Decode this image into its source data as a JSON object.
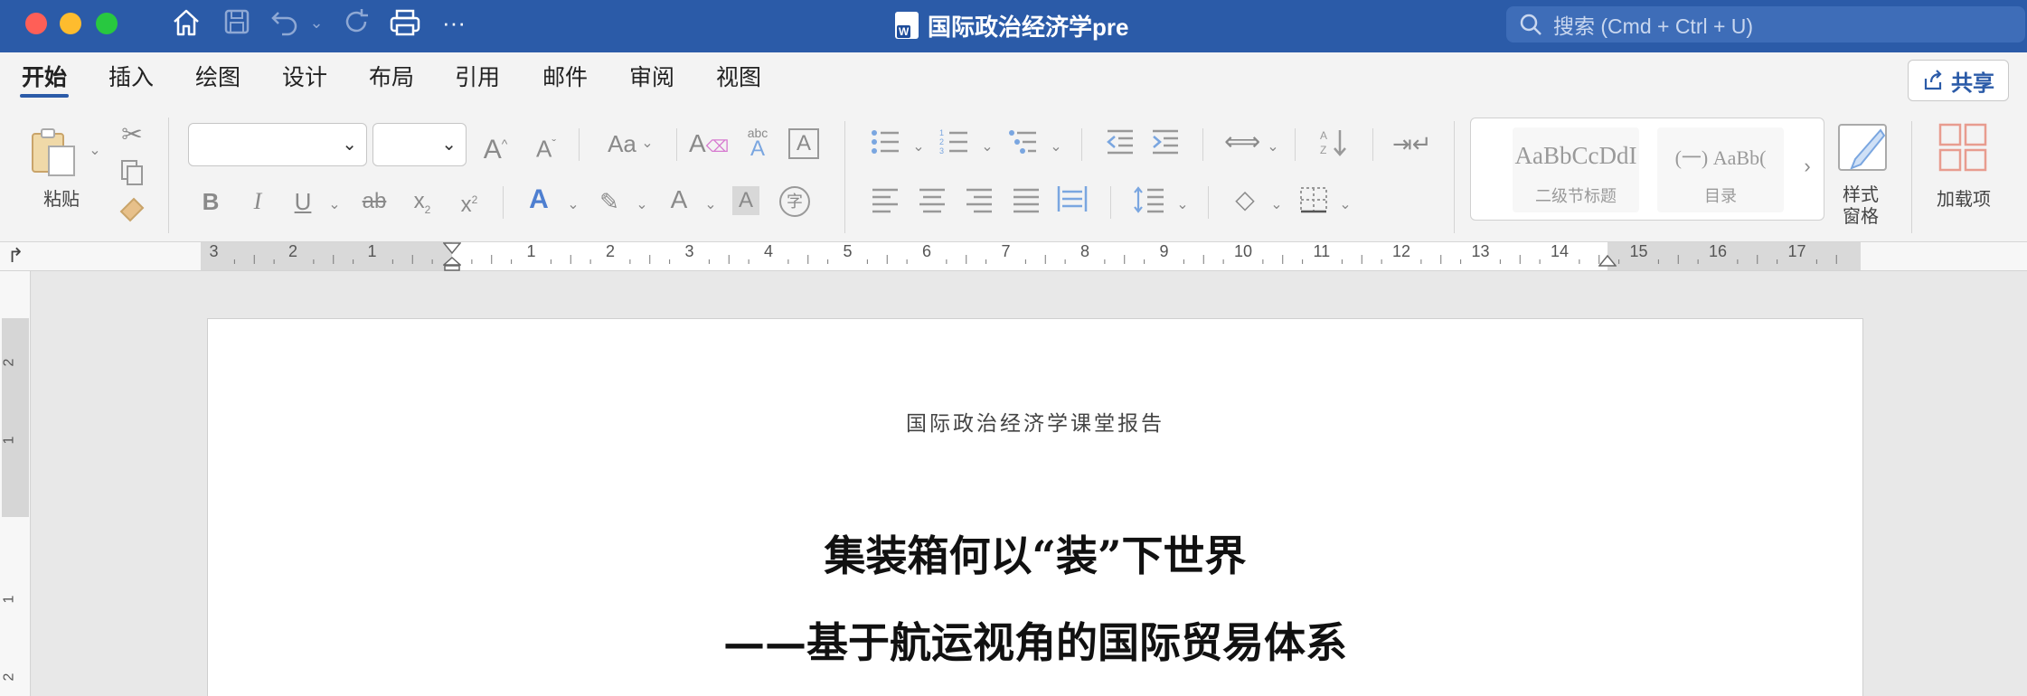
{
  "window": {
    "title": "国际政治经济学pre",
    "search_placeholder": "搜索 (Cmd + Ctrl + U)"
  },
  "tabs": [
    {
      "label": "开始",
      "active": true
    },
    {
      "label": "插入"
    },
    {
      "label": "绘图"
    },
    {
      "label": "设计"
    },
    {
      "label": "布局"
    },
    {
      "label": "引用"
    },
    {
      "label": "邮件"
    },
    {
      "label": "审阅"
    },
    {
      "label": "视图"
    }
  ],
  "share_label": "共享",
  "ribbon": {
    "paste_label": "粘贴",
    "font_name": "",
    "font_size": "",
    "styles": [
      {
        "sample": "AaBbCcDdI",
        "name": "二级节标题"
      },
      {
        "sample": "(一)  AaBb(",
        "name": "目录"
      }
    ],
    "styles_pane_label": "样式\n窗格",
    "styles_pane_line1": "样式",
    "styles_pane_line2": "窗格",
    "addins_label": "加载项"
  },
  "ruler": {
    "numbers_left": [
      "3",
      "2",
      "1"
    ],
    "numbers_right": [
      "1",
      "2",
      "3",
      "4",
      "5",
      "6",
      "7",
      "8",
      "9",
      "10",
      "11",
      "12",
      "13",
      "14",
      "15",
      "16",
      "17"
    ]
  },
  "document": {
    "header": "国际政治经济学课堂报告",
    "title": "集装箱何以“装”下世界",
    "subtitle": "——基于航运视角的国际贸易体系"
  },
  "colors": {
    "titlebar": "#2b5ba8",
    "accent": "#2b5ba8"
  }
}
